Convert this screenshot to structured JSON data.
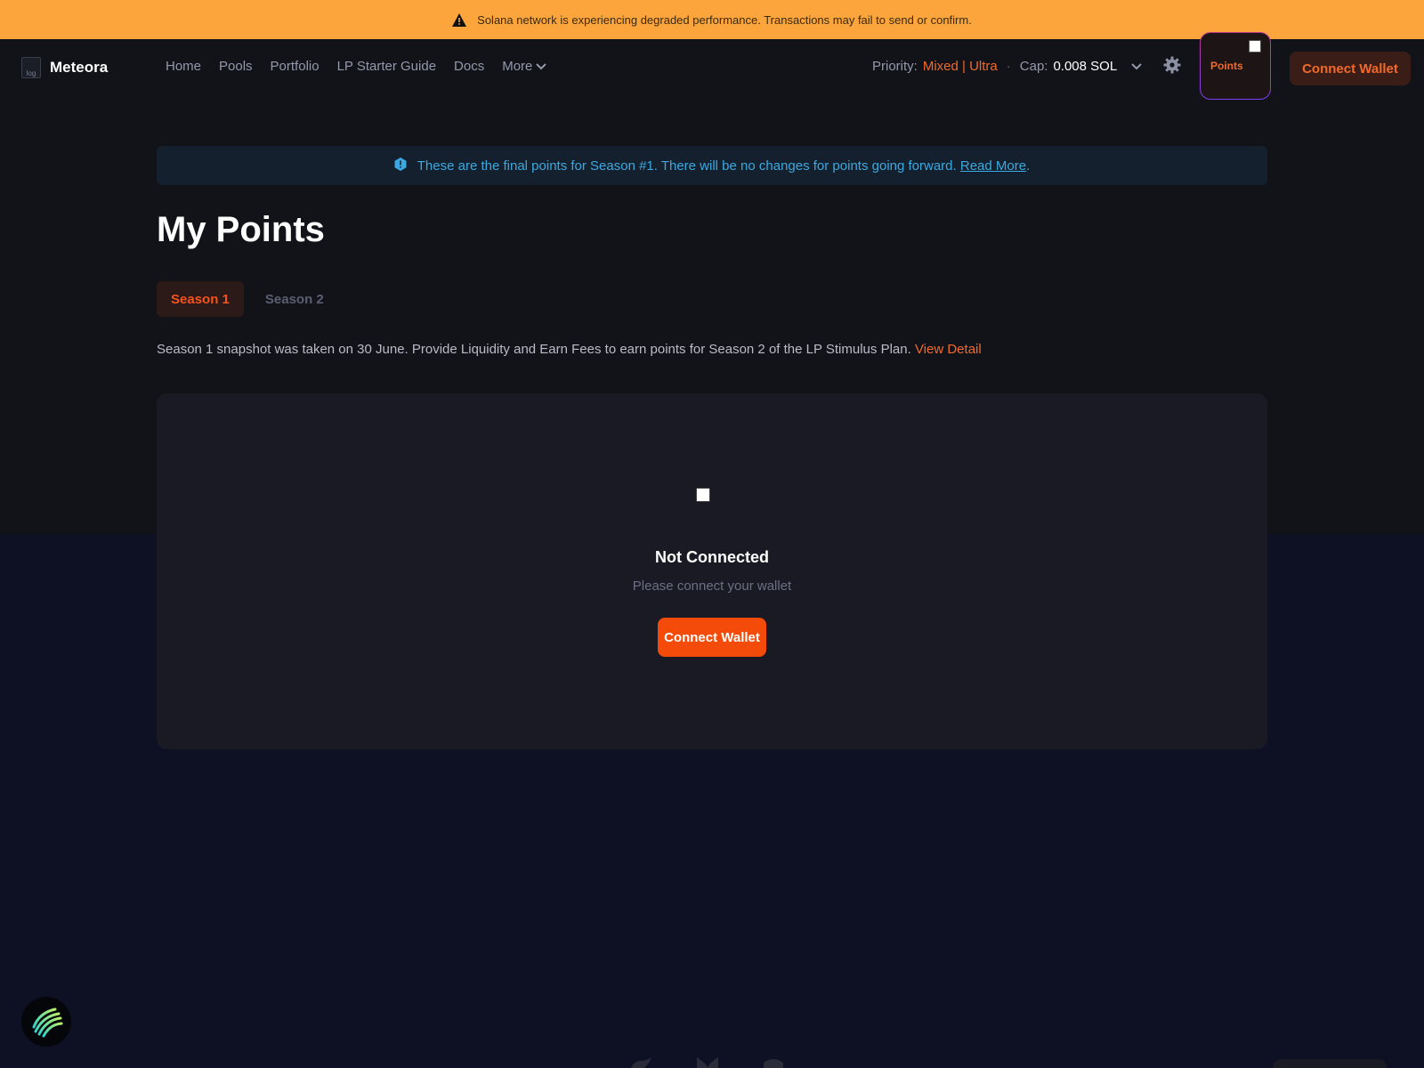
{
  "banner": {
    "icon": "warning-icon",
    "text": "Solana network is experiencing degraded performance. Transactions may fail to send or confirm."
  },
  "navbar": {
    "brand": "Meteora",
    "logo_alt": "log",
    "links": [
      {
        "label": "Home"
      },
      {
        "label": "Pools"
      },
      {
        "label": "Portfolio"
      },
      {
        "label": "LP Starter Guide"
      },
      {
        "label": "Docs"
      },
      {
        "label": "More"
      }
    ],
    "priority_label": "Priority:",
    "priority_value": "Mixed | Ultra",
    "cap_label": "Cap:",
    "cap_value": "0.008 SOL",
    "points_label": "Points",
    "connect_label": "Connect Wallet"
  },
  "info": {
    "text": "These are the final points for Season #1. There will be no changes for points going forward.",
    "link": "Read More",
    "suffix": "."
  },
  "page": {
    "title": "My Points"
  },
  "tabs": [
    {
      "label": "Season 1",
      "active": true
    },
    {
      "label": "Season 2",
      "active": false
    }
  ],
  "season_desc": {
    "text": "Season 1 snapshot was taken on 30 June. Provide Liquidity and Earn Fees to earn points for Season 2 of the LP Stimulus Plan.",
    "link": "View Detail"
  },
  "card": {
    "title": "Not Connected",
    "subtitle": "Please connect your wallet",
    "button": "Connect Wallet"
  },
  "colors": {
    "accent": "#f26a2b",
    "banner": "#fda53d",
    "info": "#3ba9e0",
    "button": "#f54b0a"
  }
}
